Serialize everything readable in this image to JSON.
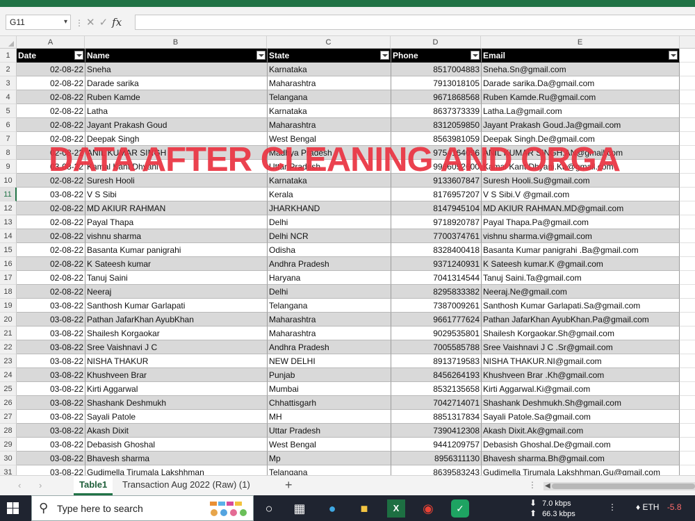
{
  "formula_bar": {
    "cell_ref": "G11",
    "dropdown_icon": "chevron-down-icon"
  },
  "columns": [
    "A",
    "B",
    "C",
    "D",
    "E"
  ],
  "table": {
    "headers": [
      "Date",
      "Name",
      "State",
      "Phone",
      "Email"
    ],
    "rows": [
      [
        "02-08-22",
        "Sneha",
        "Karnataka",
        "8517004883",
        "Sneha.Sn@gmail.com"
      ],
      [
        "02-08-22",
        "Darade sarika",
        "Maharashtra",
        "7913018105",
        "Darade sarika.Da@gmail.com"
      ],
      [
        "02-08-22",
        "Ruben Kamde",
        "Telangana",
        "9671868568",
        "Ruben Kamde.Ru@gmail.com"
      ],
      [
        "02-08-22",
        "Latha",
        "Karnataka",
        "8637373339",
        "Latha.La@gmail.com"
      ],
      [
        "02-08-22",
        "Jayant Prakash Goud",
        "Maharashtra",
        "8312059850",
        "Jayant Prakash Goud.Ja@gmail.com"
      ],
      [
        "02-08-22",
        "Deepak Singh",
        "West Bengal",
        "8563981059",
        "Deepak Singh.De@gmail.com"
      ],
      [
        "02-08-22",
        "ANIL KUMAR SINGH",
        "Madhya Pradesh",
        "9754164096",
        "ANIL KUMAR SINGH.AN@gmail.com"
      ],
      [
        "03-08-22",
        "Kamal Kant Dhyani",
        "Uttar Pradesh",
        "9966092600",
        "Kamal Kant Dhyani.Ka@gmail.com"
      ],
      [
        "02-08-22",
        "Suresh Hooli",
        "Karnataka",
        "9133607847",
        "Suresh Hooli.Su@gmail.com"
      ],
      [
        "03-08-22",
        "V S Sibi",
        "Kerala",
        "8176957207",
        "V S Sibi.V @gmail.com"
      ],
      [
        "02-08-22",
        "MD AKIUR RAHMAN",
        "JHARKHAND",
        "8147945104",
        "MD AKIUR RAHMAN.MD@gmail.com"
      ],
      [
        "02-08-22",
        "Payal Thapa",
        "Delhi",
        "9718920787",
        "Payal Thapa.Pa@gmail.com"
      ],
      [
        "02-08-22",
        "vishnu sharma",
        "Delhi NCR",
        "7700374761",
        "vishnu sharma.vi@gmail.com"
      ],
      [
        "02-08-22",
        "Basanta Kumar panigrahi",
        "Odisha",
        "8328400418",
        "Basanta Kumar panigrahi .Ba@gmail.com"
      ],
      [
        "02-08-22",
        "K Sateesh kumar",
        "Andhra Pradesh",
        "9371240931",
        "K Sateesh kumar.K @gmail.com"
      ],
      [
        "02-08-22",
        "Tanuj Saini",
        "Haryana",
        "7041314544",
        "Tanuj Saini.Ta@gmail.com"
      ],
      [
        "02-08-22",
        "Neeraj",
        "Delhi",
        "8295833382",
        "Neeraj.Ne@gmail.com"
      ],
      [
        "03-08-22",
        "Santhosh Kumar Garlapati",
        "Telangana",
        "7387009261",
        "Santhosh Kumar Garlapati.Sa@gmail.com"
      ],
      [
        "03-08-22",
        "Pathan JafarKhan AyubKhan",
        "Maharashtra",
        "9661777624",
        "Pathan JafarKhan AyubKhan.Pa@gmail.com"
      ],
      [
        "03-08-22",
        "Shailesh Korgaokar",
        "Maharashtra",
        "9029535801",
        "Shailesh Korgaokar.Sh@gmail.com"
      ],
      [
        "03-08-22",
        "Sree Vaishnavi J C",
        "Andhra Pradesh",
        "7005585788",
        "Sree Vaishnavi J C .Sr@gmail.com"
      ],
      [
        "03-08-22",
        "NISHA THAKUR",
        "NEW DELHI",
        "8913719583",
        "NISHA THAKUR.NI@gmail.com"
      ],
      [
        "03-08-22",
        "Khushveen Brar",
        "Punjab",
        "8456264193",
        "Khushveen Brar .Kh@gmail.com"
      ],
      [
        "03-08-22",
        "Kirti Aggarwal",
        "Mumbai",
        "8532135658",
        "Kirti Aggarwal.Ki@gmail.com"
      ],
      [
        "03-08-22",
        "Shashank Deshmukh",
        "Chhattisgarh",
        "7042714071",
        "Shashank Deshmukh.Sh@gmail.com"
      ],
      [
        "03-08-22",
        "Sayali Patole",
        "MH",
        "8851317834",
        "Sayali Patole.Sa@gmail.com"
      ],
      [
        "03-08-22",
        "Akash Dixit",
        "Uttar Pradesh",
        "7390412308",
        "Akash Dixit.Ak@gmail.com"
      ],
      [
        "03-08-22",
        "Debasish Ghoshal",
        "West Bengal",
        "9441209757",
        "Debasish Ghoshal.De@gmail.com"
      ],
      [
        "03-08-22",
        "Bhavesh sharma",
        "Mp",
        "8956311130",
        "Bhavesh sharma.Bh@gmail.com"
      ],
      [
        "03-08-22",
        "Gudimella Tirumala Lakshhman",
        "Telangana",
        "8639583243",
        "Gudimella Tirumala Lakshhman.Gu@gmail.com"
      ]
    ],
    "selected_row": 11
  },
  "overlay_text": "DATA AFTER CLEANING AND ORGA",
  "sheet_tabs": [
    {
      "label": "Table1",
      "active": true
    },
    {
      "label": "Transaction Aug 2022 (Raw) (1)",
      "active": false
    }
  ],
  "taskbar": {
    "search_placeholder": "Type here to search",
    "upload_speed": "7.0 kbps",
    "download_speed": "66.3 kbps",
    "ticker": "ETH",
    "ticker_change": "-5.8"
  }
}
